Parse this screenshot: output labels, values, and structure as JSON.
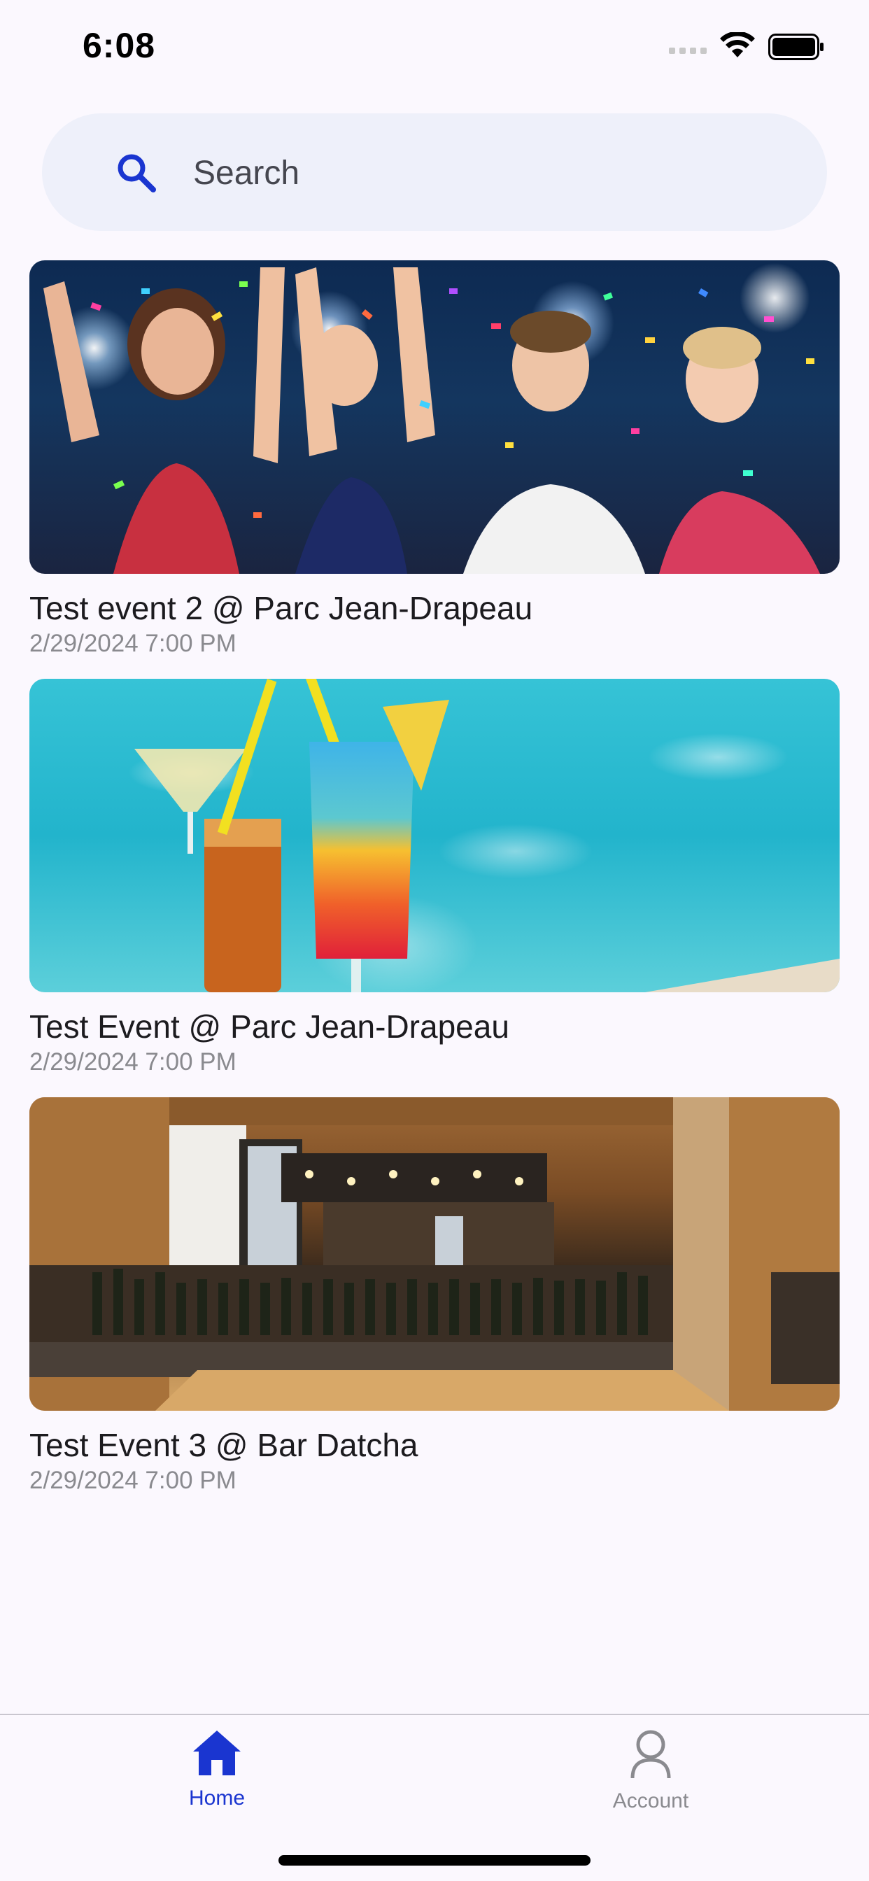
{
  "status_bar": {
    "time": "6:08"
  },
  "search": {
    "placeholder": "Search"
  },
  "events": [
    {
      "title": "Test event 2 @ Parc Jean-Drapeau",
      "date": "2/29/2024 7:00 PM",
      "image": "party-confetti-photo"
    },
    {
      "title": "Test Event @ Parc Jean-Drapeau",
      "date": "2/29/2024 7:00 PM",
      "image": "cocktails-pool-photo"
    },
    {
      "title": "Test Event 3 @ Bar Datcha",
      "date": "2/29/2024 7:00 PM",
      "image": "bar-interior-photo"
    }
  ],
  "tabs": [
    {
      "label": "Home",
      "icon": "home-icon",
      "active": true
    },
    {
      "label": "Account",
      "icon": "person-icon",
      "active": false
    }
  ],
  "colors": {
    "accent": "#1a35d0",
    "background": "#fbf8fe",
    "search_bg": "#eef0fa",
    "muted": "#8a8a8f"
  }
}
